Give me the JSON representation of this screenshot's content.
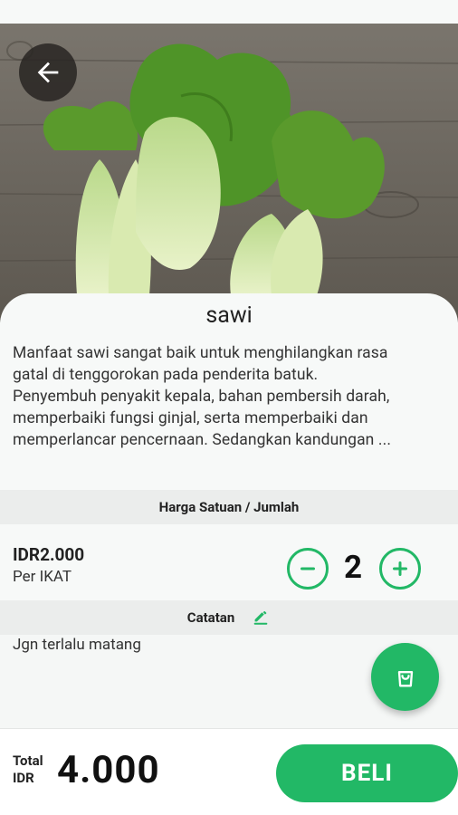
{
  "product": {
    "name": "sawi",
    "description_lines": [
      "Manfaat sawi sangat baik untuk menghilangkan rasa",
      "gatal di tenggorokan pada penderita batuk.",
      "Penyembuh penyakit kepala, bahan pembersih darah,",
      "memperbaiki fungsi ginjal, serta memperbaiki dan",
      "memperlancar pencernaan. Sedangkan kandungan ..."
    ],
    "image_icon": "bok-choy-photo"
  },
  "price_section": {
    "header": "Harga Satuan / Jumlah",
    "price": "IDR2.000",
    "unit": "Per IKAT",
    "quantity": "2",
    "decrement_icon": "minus-circle-icon",
    "increment_icon": "plus-circle-icon"
  },
  "note_section": {
    "header": "Catatan",
    "edit_icon": "pencil-icon",
    "note": "Jgn terlalu matang"
  },
  "footer": {
    "total_label": "Total",
    "currency": "IDR",
    "total_value": "4.000",
    "buy_label": "BELI"
  },
  "colors": {
    "accent": "#22b866",
    "background": "#f7f9f8",
    "section_header": "#ebedec"
  },
  "icons": {
    "back": "arrow-left-icon",
    "cart": "shopping-bag-icon"
  }
}
